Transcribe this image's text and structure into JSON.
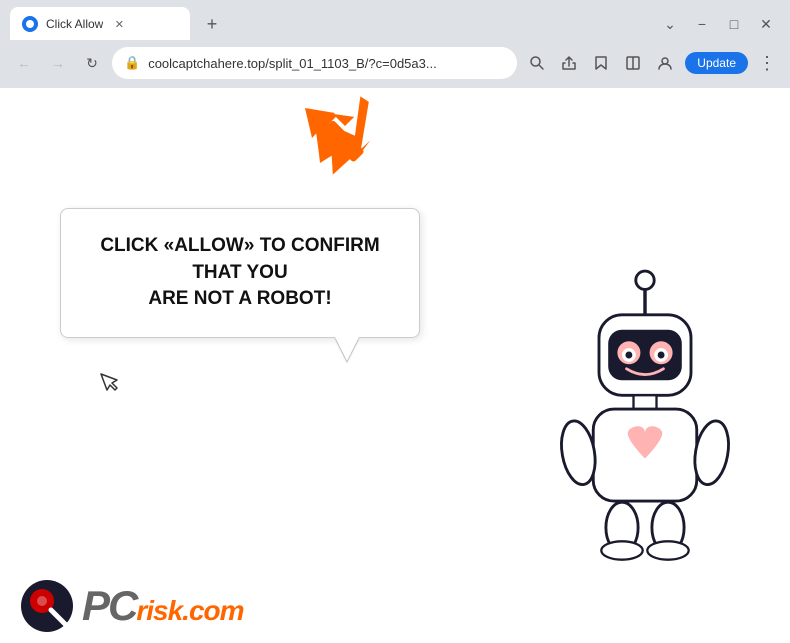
{
  "browser": {
    "tab": {
      "title": "Click Allow",
      "favicon_label": "site-icon"
    },
    "new_tab_label": "+",
    "window_controls": {
      "chevron_down": "⌄",
      "minimize": "−",
      "maximize": "□",
      "close": "✕"
    },
    "nav": {
      "back": "←",
      "forward": "→",
      "refresh": "↻"
    },
    "address": {
      "lock": "🔒",
      "url": "coolcaptchahere.top/split_01_1103_B/?c=0d5a3..."
    },
    "toolbar_icons": {
      "search": "🔍",
      "share": "↗",
      "bookmark": "☆",
      "split": "⊡",
      "profile": "👤"
    },
    "update_button": "Update",
    "menu_dots": "⋮"
  },
  "page": {
    "bubble_text_line1": "CLICK «ALLOW» TO CONFIRM THAT YOU",
    "bubble_text_line2": "ARE NOT A ROBOT!",
    "logo": {
      "pc": "PC",
      "risk": "risk",
      "domain": ".com"
    }
  },
  "colors": {
    "orange": "#ff6600",
    "blue": "#1a73e8",
    "dark": "#1a1a2e",
    "red": "#cc0000"
  }
}
